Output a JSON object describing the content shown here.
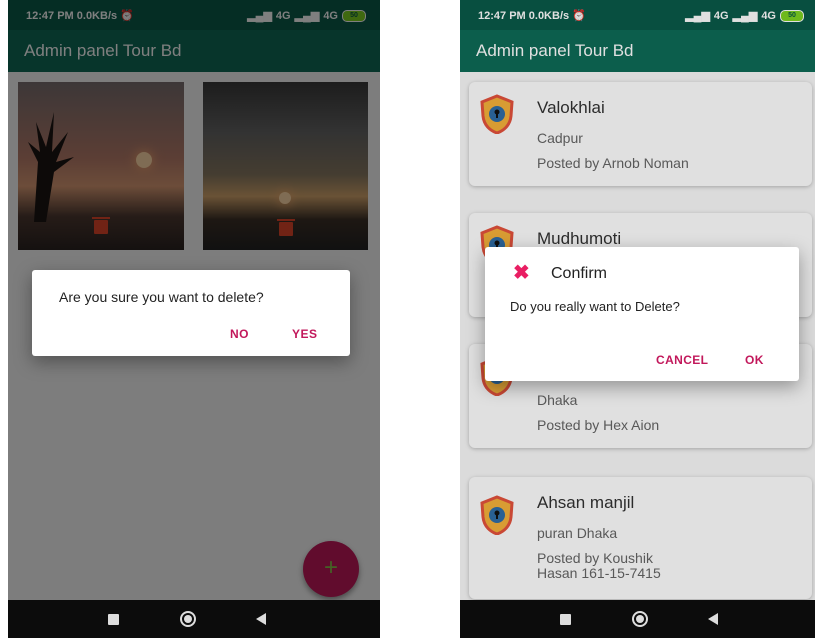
{
  "status_bar": {
    "time": "12:47 PM",
    "speed": "0.0KB/s",
    "signal": "4G",
    "signal2": "4G",
    "battery": "50"
  },
  "app_title": "Admin panel Tour Bd",
  "left_screen": {
    "dialog": {
      "message": "Are you sure you want to delete?",
      "no_label": "NO",
      "yes_label": "YES"
    },
    "fab_icon": "plus-icon"
  },
  "right_screen": {
    "cards": [
      {
        "title": "Valokhlai",
        "place": "Cadpur",
        "posted_by": "Posted by Arnob Noman"
      },
      {
        "title": "Mudhumoti",
        "place": "",
        "posted_by": ""
      },
      {
        "title": "",
        "place": "Dhaka",
        "posted_by": "Posted by Hex Aion"
      },
      {
        "title": "Ahsan manjil",
        "place": "puran Dhaka",
        "posted_by": "Posted by Koushik Hasan 161-15-7415"
      }
    ],
    "dialog": {
      "title": "Confirm",
      "message": "Do you really want to Delete?",
      "cancel_label": "CANCEL",
      "ok_label": "OK",
      "icon": "close-icon"
    }
  },
  "colors": {
    "app_bar": "#0e6b57",
    "accent": "#c2185b",
    "dialog_icon": "#e91e63"
  }
}
